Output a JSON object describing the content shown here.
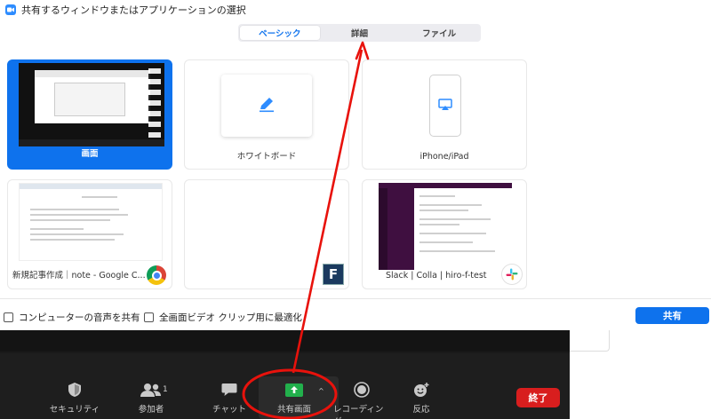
{
  "window": {
    "title": "共有するウィンドウまたはアプリケーションの選択"
  },
  "tabs": [
    {
      "label": "ベーシック",
      "active": true
    },
    {
      "label": "詳細",
      "active": false
    },
    {
      "label": "ファイル",
      "active": false
    }
  ],
  "cards": [
    {
      "label": "画面",
      "selected": true
    },
    {
      "label": "ホワイトボード",
      "selected": false
    },
    {
      "label": "iPhone/iPad",
      "selected": false
    },
    {
      "label": "新規記事作成｜note - Google C...",
      "selected": false
    },
    {
      "label": "",
      "selected": false
    },
    {
      "label": "Slack | Colla | hiro-f-test",
      "selected": false
    }
  ],
  "options": {
    "share_audio": "コンピューターの音声を共有",
    "optimize_video": "全画面ビデオ クリップ用に最適化"
  },
  "share_button": "共有",
  "toolbar": {
    "security": "セキュリティ",
    "participants": "参加者",
    "participants_count": "1",
    "chat": "チャット",
    "share_screen": "共有画面",
    "record": "レコーディング",
    "reactions": "反応",
    "end": "終了"
  },
  "colors": {
    "accent": "#0e72ed",
    "share_green": "#22b04c",
    "end_red": "#d81e1e",
    "annotation_red": "#e8120c"
  },
  "icons": [
    "zoom-app-icon",
    "pencil-icon",
    "airplay-icon",
    "chrome-icon",
    "f-app-icon",
    "slack-icon",
    "shield-icon",
    "participants-icon",
    "chat-icon",
    "share-arrow-icon",
    "record-icon",
    "reaction-icon"
  ]
}
